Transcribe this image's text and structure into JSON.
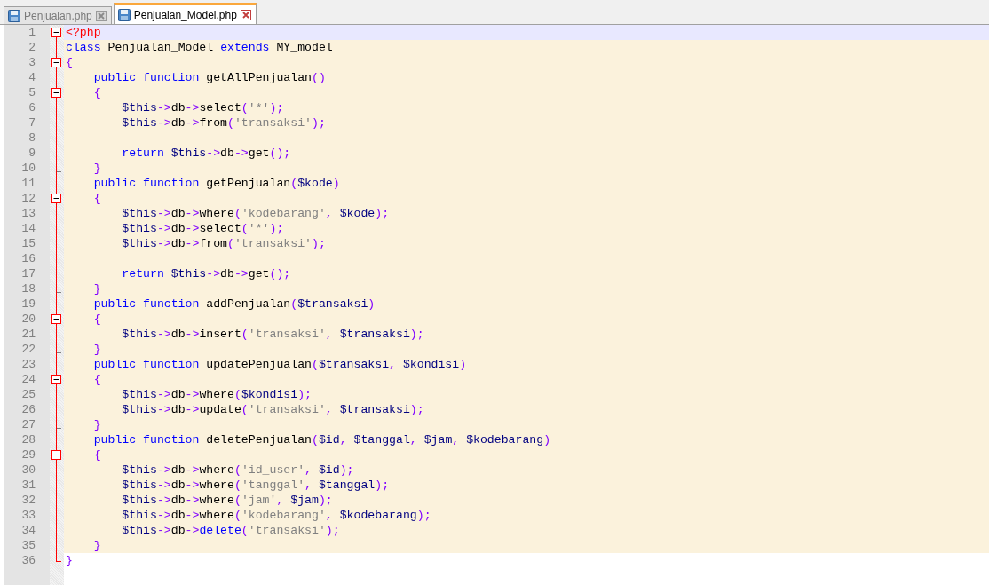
{
  "tabs": [
    {
      "label": "Penjualan.php",
      "selected": false
    },
    {
      "label": "Penjualan_Model.php",
      "selected": true
    }
  ],
  "lines": [
    {
      "number": "1",
      "fold_start": true,
      "fold_end": false,
      "current": true,
      "in_block": false,
      "tokens": [
        {
          "kind": "tag",
          "text": "<?php"
        }
      ]
    },
    {
      "number": "2",
      "fold_start": false,
      "fold_end": false,
      "current": false,
      "in_block": true,
      "tokens": [
        {
          "kind": "keyword",
          "text": "class"
        },
        {
          "kind": "plain",
          "text": " Penjualan_Model "
        },
        {
          "kind": "keyword",
          "text": "extends"
        },
        {
          "kind": "plain",
          "text": " MY_model"
        }
      ]
    },
    {
      "number": "3",
      "fold_start": true,
      "fold_end": false,
      "current": false,
      "in_block": true,
      "tokens": [
        {
          "kind": "operator",
          "text": "{"
        }
      ]
    },
    {
      "number": "4",
      "fold_start": false,
      "fold_end": false,
      "current": false,
      "in_block": true,
      "tokens": [
        {
          "kind": "keyword",
          "text": "    public function"
        },
        {
          "kind": "plain",
          "text": " getAllPenjualan"
        },
        {
          "kind": "operator",
          "text": "()"
        }
      ]
    },
    {
      "number": "5",
      "fold_start": true,
      "fold_end": false,
      "current": false,
      "in_block": true,
      "tokens": [
        {
          "kind": "operator",
          "text": "    {"
        }
      ]
    },
    {
      "number": "6",
      "fold_start": false,
      "fold_end": false,
      "current": false,
      "in_block": true,
      "tokens": [
        {
          "kind": "variable",
          "text": "        $this"
        },
        {
          "kind": "operator",
          "text": "->"
        },
        {
          "kind": "plain",
          "text": "db"
        },
        {
          "kind": "operator",
          "text": "->"
        },
        {
          "kind": "plain",
          "text": "select"
        },
        {
          "kind": "operator",
          "text": "("
        },
        {
          "kind": "string",
          "text": "'*'"
        },
        {
          "kind": "operator",
          "text": ");"
        }
      ]
    },
    {
      "number": "7",
      "fold_start": false,
      "fold_end": false,
      "current": false,
      "in_block": true,
      "tokens": [
        {
          "kind": "variable",
          "text": "        $this"
        },
        {
          "kind": "operator",
          "text": "->"
        },
        {
          "kind": "plain",
          "text": "db"
        },
        {
          "kind": "operator",
          "text": "->"
        },
        {
          "kind": "plain",
          "text": "from"
        },
        {
          "kind": "operator",
          "text": "("
        },
        {
          "kind": "string",
          "text": "'transaksi'"
        },
        {
          "kind": "operator",
          "text": ");"
        }
      ]
    },
    {
      "number": "8",
      "fold_start": false,
      "fold_end": false,
      "current": false,
      "in_block": true
    },
    {
      "number": "9",
      "fold_start": false,
      "fold_end": false,
      "current": false,
      "in_block": true,
      "tokens": [
        {
          "kind": "keyword",
          "text": "        return"
        },
        {
          "kind": "variable",
          "text": " $this"
        },
        {
          "kind": "operator",
          "text": "->"
        },
        {
          "kind": "plain",
          "text": "db"
        },
        {
          "kind": "operator",
          "text": "->"
        },
        {
          "kind": "plain",
          "text": "get"
        },
        {
          "kind": "operator",
          "text": "();"
        }
      ]
    },
    {
      "number": "10",
      "fold_start": false,
      "fold_end": true,
      "current": false,
      "in_block": true,
      "tokens": [
        {
          "kind": "operator",
          "text": "    }"
        }
      ]
    },
    {
      "number": "11",
      "fold_start": false,
      "fold_end": false,
      "current": false,
      "in_block": true,
      "tokens": [
        {
          "kind": "keyword",
          "text": "    public function"
        },
        {
          "kind": "plain",
          "text": " getPenjualan"
        },
        {
          "kind": "operator",
          "text": "("
        },
        {
          "kind": "variable",
          "text": "$kode"
        },
        {
          "kind": "operator",
          "text": ")"
        }
      ]
    },
    {
      "number": "12",
      "fold_start": true,
      "fold_end": false,
      "current": false,
      "in_block": true,
      "tokens": [
        {
          "kind": "operator",
          "text": "    {"
        }
      ]
    },
    {
      "number": "13",
      "fold_start": false,
      "fold_end": false,
      "current": false,
      "in_block": true,
      "tokens": [
        {
          "kind": "variable",
          "text": "        $this"
        },
        {
          "kind": "operator",
          "text": "->"
        },
        {
          "kind": "plain",
          "text": "db"
        },
        {
          "kind": "operator",
          "text": "->"
        },
        {
          "kind": "plain",
          "text": "where"
        },
        {
          "kind": "operator",
          "text": "("
        },
        {
          "kind": "string",
          "text": "'kodebarang'"
        },
        {
          "kind": "operator",
          "text": ", "
        },
        {
          "kind": "variable",
          "text": "$kode"
        },
        {
          "kind": "operator",
          "text": ");"
        }
      ]
    },
    {
      "number": "14",
      "fold_start": false,
      "fold_end": false,
      "current": false,
      "in_block": true,
      "tokens": [
        {
          "kind": "variable",
          "text": "        $this"
        },
        {
          "kind": "operator",
          "text": "->"
        },
        {
          "kind": "plain",
          "text": "db"
        },
        {
          "kind": "operator",
          "text": "->"
        },
        {
          "kind": "plain",
          "text": "select"
        },
        {
          "kind": "operator",
          "text": "("
        },
        {
          "kind": "string",
          "text": "'*'"
        },
        {
          "kind": "operator",
          "text": ");"
        }
      ]
    },
    {
      "number": "15",
      "fold_start": false,
      "fold_end": false,
      "current": false,
      "in_block": true,
      "tokens": [
        {
          "kind": "variable",
          "text": "        $this"
        },
        {
          "kind": "operator",
          "text": "->"
        },
        {
          "kind": "plain",
          "text": "db"
        },
        {
          "kind": "operator",
          "text": "->"
        },
        {
          "kind": "plain",
          "text": "from"
        },
        {
          "kind": "operator",
          "text": "("
        },
        {
          "kind": "string",
          "text": "'transaksi'"
        },
        {
          "kind": "operator",
          "text": ");"
        }
      ]
    },
    {
      "number": "16",
      "fold_start": false,
      "fold_end": false,
      "current": false,
      "in_block": true
    },
    {
      "number": "17",
      "fold_start": false,
      "fold_end": false,
      "current": false,
      "in_block": true,
      "tokens": [
        {
          "kind": "keyword",
          "text": "        return"
        },
        {
          "kind": "variable",
          "text": " $this"
        },
        {
          "kind": "operator",
          "text": "->"
        },
        {
          "kind": "plain",
          "text": "db"
        },
        {
          "kind": "operator",
          "text": "->"
        },
        {
          "kind": "plain",
          "text": "get"
        },
        {
          "kind": "operator",
          "text": "();"
        }
      ]
    },
    {
      "number": "18",
      "fold_start": false,
      "fold_end": true,
      "current": false,
      "in_block": true,
      "tokens": [
        {
          "kind": "operator",
          "text": "    }"
        }
      ]
    },
    {
      "number": "19",
      "fold_start": false,
      "fold_end": false,
      "current": false,
      "in_block": true,
      "tokens": [
        {
          "kind": "keyword",
          "text": "    public function"
        },
        {
          "kind": "plain",
          "text": " addPenjualan"
        },
        {
          "kind": "operator",
          "text": "("
        },
        {
          "kind": "variable",
          "text": "$transaksi"
        },
        {
          "kind": "operator",
          "text": ")"
        }
      ]
    },
    {
      "number": "20",
      "fold_start": true,
      "fold_end": false,
      "current": false,
      "in_block": true,
      "tokens": [
        {
          "kind": "operator",
          "text": "    {"
        }
      ]
    },
    {
      "number": "21",
      "fold_start": false,
      "fold_end": false,
      "current": false,
      "in_block": true,
      "tokens": [
        {
          "kind": "variable",
          "text": "        $this"
        },
        {
          "kind": "operator",
          "text": "->"
        },
        {
          "kind": "plain",
          "text": "db"
        },
        {
          "kind": "operator",
          "text": "->"
        },
        {
          "kind": "plain",
          "text": "insert"
        },
        {
          "kind": "operator",
          "text": "("
        },
        {
          "kind": "string",
          "text": "'transaksi'"
        },
        {
          "kind": "operator",
          "text": ", "
        },
        {
          "kind": "variable",
          "text": "$transaksi"
        },
        {
          "kind": "operator",
          "text": ");"
        }
      ]
    },
    {
      "number": "22",
      "fold_start": false,
      "fold_end": true,
      "current": false,
      "in_block": true,
      "tokens": [
        {
          "kind": "operator",
          "text": "    }"
        }
      ]
    },
    {
      "number": "23",
      "fold_start": false,
      "fold_end": false,
      "current": false,
      "in_block": true,
      "tokens": [
        {
          "kind": "keyword",
          "text": "    public function"
        },
        {
          "kind": "plain",
          "text": " updatePenjualan"
        },
        {
          "kind": "operator",
          "text": "("
        },
        {
          "kind": "variable",
          "text": "$transaksi"
        },
        {
          "kind": "operator",
          "text": ", "
        },
        {
          "kind": "variable",
          "text": "$kondisi"
        },
        {
          "kind": "operator",
          "text": ")"
        }
      ]
    },
    {
      "number": "24",
      "fold_start": true,
      "fold_end": false,
      "current": false,
      "in_block": true,
      "tokens": [
        {
          "kind": "operator",
          "text": "    {"
        }
      ]
    },
    {
      "number": "25",
      "fold_start": false,
      "fold_end": false,
      "current": false,
      "in_block": true,
      "tokens": [
        {
          "kind": "variable",
          "text": "        $this"
        },
        {
          "kind": "operator",
          "text": "->"
        },
        {
          "kind": "plain",
          "text": "db"
        },
        {
          "kind": "operator",
          "text": "->"
        },
        {
          "kind": "plain",
          "text": "where"
        },
        {
          "kind": "operator",
          "text": "("
        },
        {
          "kind": "variable",
          "text": "$kondisi"
        },
        {
          "kind": "operator",
          "text": ");"
        }
      ]
    },
    {
      "number": "26",
      "fold_start": false,
      "fold_end": false,
      "current": false,
      "in_block": true,
      "tokens": [
        {
          "kind": "variable",
          "text": "        $this"
        },
        {
          "kind": "operator",
          "text": "->"
        },
        {
          "kind": "plain",
          "text": "db"
        },
        {
          "kind": "operator",
          "text": "->"
        },
        {
          "kind": "plain",
          "text": "update"
        },
        {
          "kind": "operator",
          "text": "("
        },
        {
          "kind": "string",
          "text": "'transaksi'"
        },
        {
          "kind": "operator",
          "text": ", "
        },
        {
          "kind": "variable",
          "text": "$transaksi"
        },
        {
          "kind": "operator",
          "text": ");"
        }
      ]
    },
    {
      "number": "27",
      "fold_start": false,
      "fold_end": true,
      "current": false,
      "in_block": true,
      "tokens": [
        {
          "kind": "operator",
          "text": "    }"
        }
      ]
    },
    {
      "number": "28",
      "fold_start": false,
      "fold_end": false,
      "current": false,
      "in_block": true,
      "tokens": [
        {
          "kind": "keyword",
          "text": "    public function"
        },
        {
          "kind": "plain",
          "text": " deletePenjualan"
        },
        {
          "kind": "operator",
          "text": "("
        },
        {
          "kind": "variable",
          "text": "$id"
        },
        {
          "kind": "operator",
          "text": ", "
        },
        {
          "kind": "variable",
          "text": "$tanggal"
        },
        {
          "kind": "operator",
          "text": ", "
        },
        {
          "kind": "variable",
          "text": "$jam"
        },
        {
          "kind": "operator",
          "text": ", "
        },
        {
          "kind": "variable",
          "text": "$kodebarang"
        },
        {
          "kind": "operator",
          "text": ")"
        }
      ]
    },
    {
      "number": "29",
      "fold_start": true,
      "fold_end": false,
      "current": false,
      "in_block": true,
      "tokens": [
        {
          "kind": "operator",
          "text": "    {"
        }
      ]
    },
    {
      "number": "30",
      "fold_start": false,
      "fold_end": false,
      "current": false,
      "in_block": true,
      "tokens": [
        {
          "kind": "variable",
          "text": "        $this"
        },
        {
          "kind": "operator",
          "text": "->"
        },
        {
          "kind": "plain",
          "text": "db"
        },
        {
          "kind": "operator",
          "text": "->"
        },
        {
          "kind": "plain",
          "text": "where"
        },
        {
          "kind": "operator",
          "text": "("
        },
        {
          "kind": "string",
          "text": "'id_user'"
        },
        {
          "kind": "operator",
          "text": ", "
        },
        {
          "kind": "variable",
          "text": "$id"
        },
        {
          "kind": "operator",
          "text": ");"
        }
      ]
    },
    {
      "number": "31",
      "fold_start": false,
      "fold_end": false,
      "current": false,
      "in_block": true,
      "tokens": [
        {
          "kind": "variable",
          "text": "        $this"
        },
        {
          "kind": "operator",
          "text": "->"
        },
        {
          "kind": "plain",
          "text": "db"
        },
        {
          "kind": "operator",
          "text": "->"
        },
        {
          "kind": "plain",
          "text": "where"
        },
        {
          "kind": "operator",
          "text": "("
        },
        {
          "kind": "string",
          "text": "'tanggal'"
        },
        {
          "kind": "operator",
          "text": ", "
        },
        {
          "kind": "variable",
          "text": "$tanggal"
        },
        {
          "kind": "operator",
          "text": ");"
        }
      ]
    },
    {
      "number": "32",
      "fold_start": false,
      "fold_end": false,
      "current": false,
      "in_block": true,
      "tokens": [
        {
          "kind": "variable",
          "text": "        $this"
        },
        {
          "kind": "operator",
          "text": "->"
        },
        {
          "kind": "plain",
          "text": "db"
        },
        {
          "kind": "operator",
          "text": "->"
        },
        {
          "kind": "plain",
          "text": "where"
        },
        {
          "kind": "operator",
          "text": "("
        },
        {
          "kind": "string",
          "text": "'jam'"
        },
        {
          "kind": "operator",
          "text": ", "
        },
        {
          "kind": "variable",
          "text": "$jam"
        },
        {
          "kind": "operator",
          "text": ");"
        }
      ]
    },
    {
      "number": "33",
      "fold_start": false,
      "fold_end": false,
      "current": false,
      "in_block": true,
      "tokens": [
        {
          "kind": "variable",
          "text": "        $this"
        },
        {
          "kind": "operator",
          "text": "->"
        },
        {
          "kind": "plain",
          "text": "db"
        },
        {
          "kind": "operator",
          "text": "->"
        },
        {
          "kind": "plain",
          "text": "where"
        },
        {
          "kind": "operator",
          "text": "("
        },
        {
          "kind": "string",
          "text": "'kodebarang'"
        },
        {
          "kind": "operator",
          "text": ", "
        },
        {
          "kind": "variable",
          "text": "$kodebarang"
        },
        {
          "kind": "operator",
          "text": ");"
        }
      ]
    },
    {
      "number": "34",
      "fold_start": false,
      "fold_end": false,
      "current": false,
      "in_block": true,
      "tokens": [
        {
          "kind": "variable",
          "text": "        $this"
        },
        {
          "kind": "operator",
          "text": "->"
        },
        {
          "kind": "plain",
          "text": "db"
        },
        {
          "kind": "operator",
          "text": "->"
        },
        {
          "kind": "keyword",
          "text": "delete"
        },
        {
          "kind": "operator",
          "text": "("
        },
        {
          "kind": "string",
          "text": "'transaksi'"
        },
        {
          "kind": "operator",
          "text": ");"
        }
      ]
    },
    {
      "number": "35",
      "fold_start": false,
      "fold_end": true,
      "current": false,
      "in_block": true,
      "tokens": [
        {
          "kind": "operator",
          "text": "    }"
        }
      ]
    },
    {
      "number": "36",
      "fold_start": false,
      "fold_end": true,
      "current": false,
      "in_block": false,
      "tokens": [
        {
          "kind": "operator",
          "text": "}"
        }
      ]
    }
  ]
}
